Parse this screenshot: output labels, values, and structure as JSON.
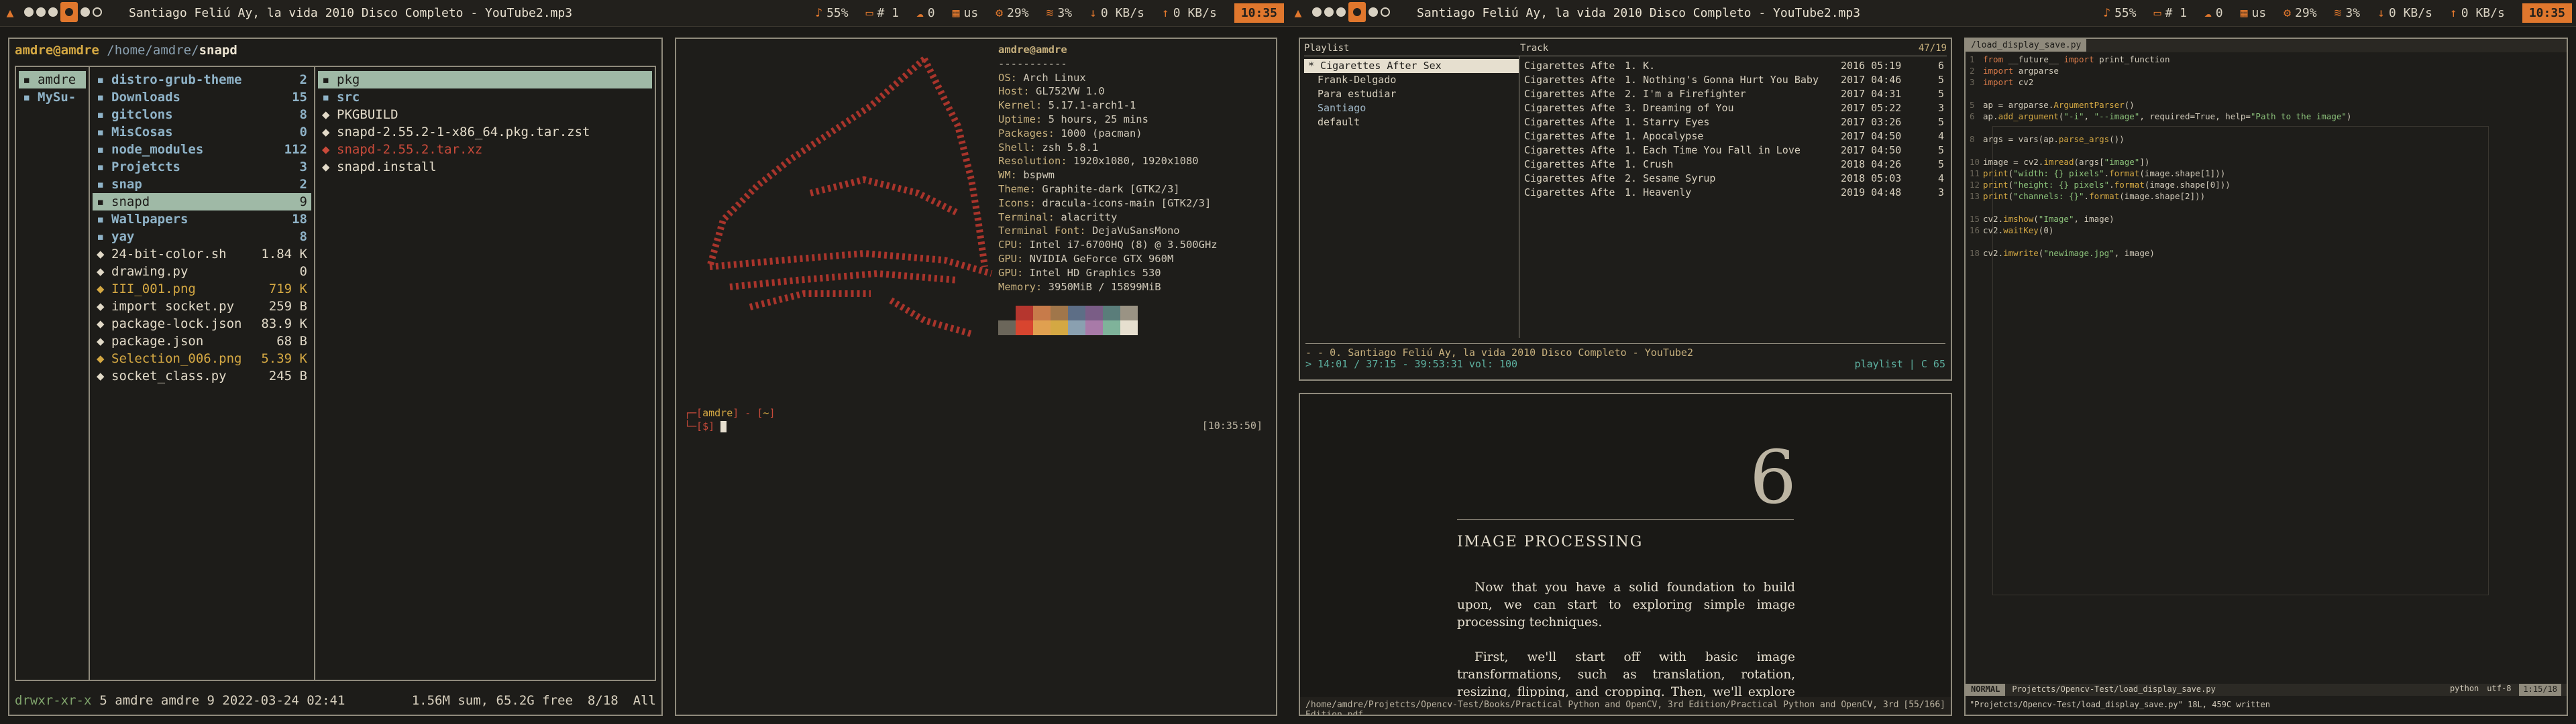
{
  "bar_left": {
    "workspaces": [
      "",
      "",
      "",
      "",
      "",
      ""
    ],
    "title": "Santiago Feliú Ay, la vida 2010 Disco Completo - YouTube2.mp3",
    "volume": "55%",
    "desktop": "# 1",
    "cloud": "0",
    "lang": "us",
    "cpu": "29%",
    "wifi": "3%",
    "down": "0 KB/s",
    "up": "0 KB/s",
    "clock": "10:35"
  },
  "bar_right": {
    "title": "Santiago Feliú Ay, la vida 2010 Disco Completo - YouTube2.mp3",
    "volume": "55%",
    "desktop": "# 1",
    "cloud": "0",
    "lang": "us",
    "cpu": "29%",
    "wifi": "3%",
    "down": "0 KB/s",
    "up": "0 KB/s",
    "clock": "10:35"
  },
  "ranger": {
    "user": "amdre@amdre",
    "path": "/home/amdre/",
    "current": "snapd",
    "col1": [
      {
        "name": "amdre",
        "type": "sel"
      },
      {
        "name": "MySu-",
        "type": "dir"
      }
    ],
    "col2": [
      {
        "name": "distro-grub-theme",
        "size": "2",
        "type": "dir"
      },
      {
        "name": "Downloads",
        "size": "15",
        "type": "dir"
      },
      {
        "name": "gitclons",
        "size": "8",
        "type": "dir"
      },
      {
        "name": "MisCosas",
        "size": "0",
        "type": "dir"
      },
      {
        "name": "node_modules",
        "size": "112",
        "type": "dir"
      },
      {
        "name": "Projetcts",
        "size": "3",
        "type": "dir"
      },
      {
        "name": "snap",
        "size": "2",
        "type": "dir"
      },
      {
        "name": "snapd",
        "size": "9",
        "type": "sel"
      },
      {
        "name": "Wallpapers",
        "size": "18",
        "type": "dir"
      },
      {
        "name": "yay",
        "size": "8",
        "type": "dir"
      },
      {
        "name": "24-bit-color.sh",
        "size": "1.84 K",
        "type": "file"
      },
      {
        "name": "drawing.py",
        "size": "0",
        "type": "file"
      },
      {
        "name": "III_001.png",
        "size": "719 K",
        "type": "img"
      },
      {
        "name": "import socket.py",
        "size": "259 B",
        "type": "file"
      },
      {
        "name": "package-lock.json",
        "size": "83.9 K",
        "type": "file"
      },
      {
        "name": "package.json",
        "size": "68 B",
        "type": "file"
      },
      {
        "name": "Selection_006.png",
        "size": "5.39 K",
        "type": "img"
      },
      {
        "name": "socket_class.py",
        "size": "245 B",
        "type": "file"
      }
    ],
    "col3": [
      {
        "name": "pkg",
        "type": "sel"
      },
      {
        "name": "src",
        "type": "dir"
      },
      {
        "name": "PKGBUILD",
        "type": "file"
      },
      {
        "name": "snapd-2.55.2-1-x86_64.pkg.tar.zst",
        "type": "file"
      },
      {
        "name": "snapd-2.55.2.tar.xz",
        "type": "red"
      },
      {
        "name": "snapd.install",
        "type": "file"
      }
    ],
    "footer": {
      "perm": "drwxr-xr-x",
      "meta": "5 amdre amdre 9 2022-03-24 02:41",
      "sum": "1.56M sum, 65.2G free",
      "pos": "8/18",
      "all": "All"
    }
  },
  "neofetch": {
    "header": "amdre@amdre",
    "sep": "-----------",
    "rows": [
      {
        "k": "OS",
        "v": "Arch Linux"
      },
      {
        "k": "Host",
        "v": "GL752VW 1.0"
      },
      {
        "k": "Kernel",
        "v": "5.17.1-arch1-1"
      },
      {
        "k": "Uptime",
        "v": "5 hours, 25 mins"
      },
      {
        "k": "Packages",
        "v": "1000 (pacman)"
      },
      {
        "k": "Shell",
        "v": "zsh 5.8.1"
      },
      {
        "k": "Resolution",
        "v": "1920x1080, 1920x1080"
      },
      {
        "k": "WM",
        "v": "bspwm"
      },
      {
        "k": "Theme",
        "v": "Graphite-dark [GTK2/3]"
      },
      {
        "k": "Icons",
        "v": "dracula-icons-main [GTK2/3]"
      },
      {
        "k": "Terminal",
        "v": "alacritty"
      },
      {
        "k": "Terminal Font",
        "v": "DejaVuSansMono"
      },
      {
        "k": "CPU",
        "v": "Intel i7-6700HQ (8) @ 3.500GHz"
      },
      {
        "k": "GPU",
        "v": "NVIDIA GeForce GTX 960M"
      },
      {
        "k": "GPU",
        "v": "Intel HD Graphics 530"
      },
      {
        "k": "Memory",
        "v": "3950MiB / 15899MiB"
      }
    ],
    "palette_top": [
      "#1e1d1a",
      "#b5362e",
      "#c77b4a",
      "#a0764a",
      "#5d6e86",
      "#7a5d86",
      "#5a7d7a",
      "#9a9384"
    ],
    "palette_bottom": [
      "#6b665a",
      "#d8452f",
      "#e0a050",
      "#d4a843",
      "#8aa0b0",
      "#a87aa8",
      "#7fb39a",
      "#e6dfcf"
    ],
    "prompt_user": "amdre",
    "prompt_path": "~",
    "prompt_time": "[10:35:50]"
  },
  "music": {
    "header_playlist": "Playlist",
    "header_track": "Track",
    "count": "47/19",
    "playlists": [
      {
        "name": "Cigarettes After Sex",
        "state": "on"
      },
      {
        "name": "Frank-Delgado",
        "state": ""
      },
      {
        "name": "Para estudiar",
        "state": ""
      },
      {
        "name": "Santiago",
        "state": "hl"
      },
      {
        "name": "default",
        "state": ""
      }
    ],
    "tracks": [
      {
        "artist": "Cigarettes Afte",
        "title": "1. K.",
        "year": "2016 05:19",
        "d": "6"
      },
      {
        "artist": "Cigarettes Afte",
        "title": "1. Nothing's Gonna Hurt You Baby",
        "year": "2017 04:46",
        "d": "5"
      },
      {
        "artist": "Cigarettes Afte",
        "title": "2. I'm a Firefighter",
        "year": "2017 04:31",
        "d": "5"
      },
      {
        "artist": "Cigarettes Afte",
        "title": "3. Dreaming of You",
        "year": "2017 05:22",
        "d": "3"
      },
      {
        "artist": "Cigarettes Afte",
        "title": "1. Starry Eyes",
        "year": "2017 03:26",
        "d": "5"
      },
      {
        "artist": "Cigarettes Afte",
        "title": "1. Apocalypse",
        "year": "2017 04:50",
        "d": "4"
      },
      {
        "artist": "Cigarettes Afte",
        "title": "1. Each Time You Fall in Love",
        "year": "2017 04:50",
        "d": "5"
      },
      {
        "artist": "Cigarettes Afte",
        "title": "1. Crush",
        "year": "2018 04:26",
        "d": "5"
      },
      {
        "artist": "Cigarettes Afte",
        "title": "2. Sesame Syrup",
        "year": "2018 05:03",
        "d": "4"
      },
      {
        "artist": "Cigarettes Afte",
        "title": "1. Heavenly",
        "year": "2019 04:48",
        "d": "3"
      }
    ],
    "now_playing": "- - 0. Santiago Feliú Ay, la vida 2010 Disco Completo - YouTube2",
    "progress": "> 14:01 / 37:15 - 39:53:31 vol: 100",
    "mode": "playlist | C 65"
  },
  "pdf": {
    "chapter": "6",
    "heading": "IMAGE PROCESSING",
    "p1": "Now that you have a solid foundation to build upon, we can start to exploring simple image processing techniques.",
    "p2": "First, we'll start off with basic image transformations, such as translation, rotation, resizing, flipping, and cropping. Then, we'll explore other types of image processing techniques, including image arithmetic, bitwise operations,",
    "status_path": "/home/amdre/Projetcts/Opencv-Test/Books/Practical Python and OpenCV, 3rd Edition/Practical Python and OpenCV, 3rd Edition.pdf",
    "status_page": "[55/166]"
  },
  "vim": {
    "tab": "/load_display_save.py",
    "mode": "NORMAL",
    "file": "Projetcts/Opencv-Test/load_display_save.py",
    "lang": "python",
    "enc": "utf-8",
    "pos": "1:15/18",
    "cmd": "\"Projetcts/Opencv-Test/load_display_save.py\" 18L, 459C written"
  }
}
